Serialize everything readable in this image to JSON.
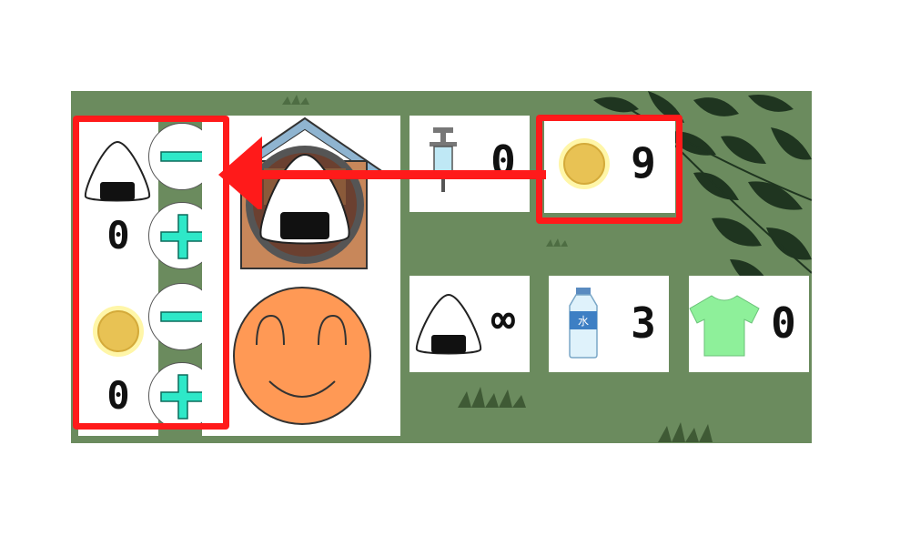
{
  "counters": {
    "syringe": "0",
    "coins": "9",
    "onigiri": "∞",
    "water": "3",
    "shirt": "0"
  },
  "controls": {
    "onigiri_amount": "0",
    "coin_amount": "0",
    "minus_symbol": "−",
    "plus_symbol": "+"
  },
  "water_label": "水",
  "colors": {
    "highlight": "#ff1a1a",
    "button_symbol": "#2ee8c8",
    "coin": "#f2d25a",
    "shirt": "#8ef09a",
    "face": "#ff9955",
    "background": "#6b8b5e"
  },
  "icons": [
    "onigiri-icon",
    "coin-icon",
    "syringe-icon",
    "water-bottle-icon",
    "shirt-icon",
    "shop-house-icon",
    "smiley-face-icon",
    "minus-icon",
    "plus-icon",
    "arrow-icon"
  ]
}
